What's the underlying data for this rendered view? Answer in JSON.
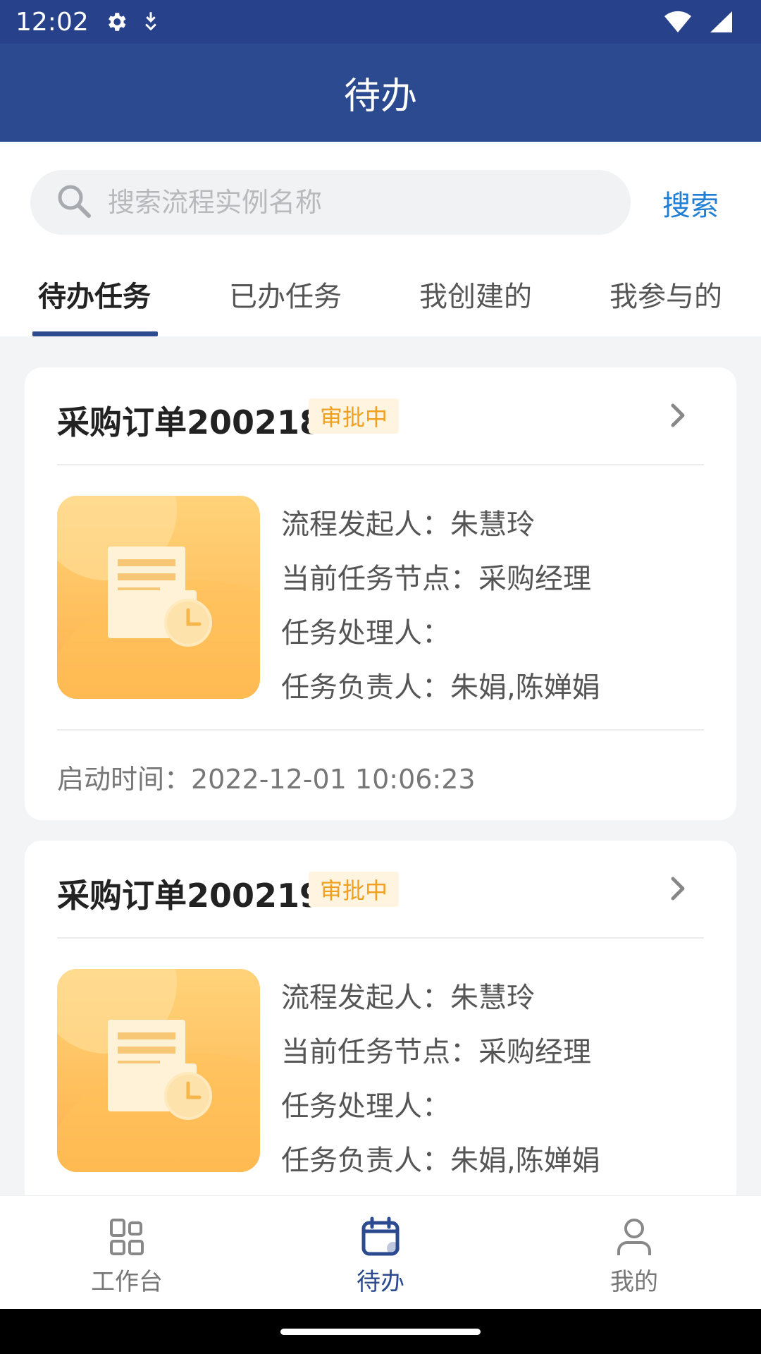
{
  "status_bar": {
    "time": "12:02",
    "icons": [
      "gear-icon",
      "download-arrow-icon",
      "wifi-icon",
      "signal-icon"
    ]
  },
  "header": {
    "title": "待办"
  },
  "search": {
    "placeholder": "搜索流程实例名称",
    "value": "",
    "button_label": "搜索"
  },
  "tabs": [
    {
      "label": "待办任务",
      "active": true
    },
    {
      "label": "已办任务",
      "active": false
    },
    {
      "label": "我创建的",
      "active": false
    },
    {
      "label": "我参与的",
      "active": false
    }
  ],
  "cards": [
    {
      "title": "采购订单200218",
      "status": "审批中",
      "lines": [
        "流程发起人：朱慧玲",
        "当前任务节点：采购经理",
        "任务处理人：",
        "任务负责人：朱娟,陈婵娟"
      ],
      "start_time": "启动时间：2022-12-01 10:06:23"
    },
    {
      "title": "采购订单200219",
      "status": "审批中",
      "lines": [
        "流程发起人：朱慧玲",
        "当前任务节点：采购经理",
        "任务处理人：",
        "任务负责人：朱娟,陈婵娟"
      ]
    }
  ],
  "bottom_nav": [
    {
      "label": "工作台",
      "icon": "grid-icon",
      "active": false
    },
    {
      "label": "待办",
      "icon": "calendar-icon",
      "active": true
    },
    {
      "label": "我的",
      "icon": "person-icon",
      "active": false
    }
  ],
  "colors": {
    "primary": "#2c4a8f",
    "link": "#1f7fd6",
    "badge_text": "#f0a020",
    "badge_bg": "#fff4e0"
  }
}
